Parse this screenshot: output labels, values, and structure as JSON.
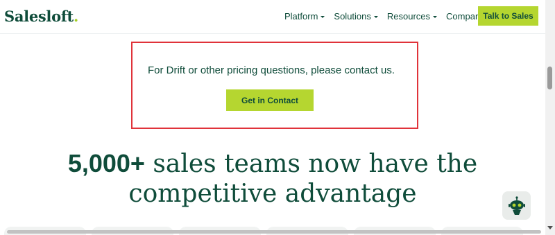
{
  "header": {
    "logo": "Salesloft",
    "logo_dot": ".",
    "nav": [
      {
        "label": "Platform"
      },
      {
        "label": "Solutions"
      },
      {
        "label": "Resources"
      },
      {
        "label": "Company"
      }
    ],
    "cta_label": "Talk to Sales"
  },
  "contact": {
    "text": "For Drift or other pricing questions, please contact us.",
    "button_label": "Get in Contact"
  },
  "headline": {
    "strong": "5,000+",
    "line1_rest": " sales teams now have the",
    "line2": "competitive advantage"
  },
  "colors": {
    "brand_green": "#0f4c3a",
    "accent_lime": "#b5d630",
    "highlight_red": "#e0333a"
  },
  "icons": {
    "chat": "robot-chat-icon",
    "dropdown": "caret-down-icon"
  }
}
